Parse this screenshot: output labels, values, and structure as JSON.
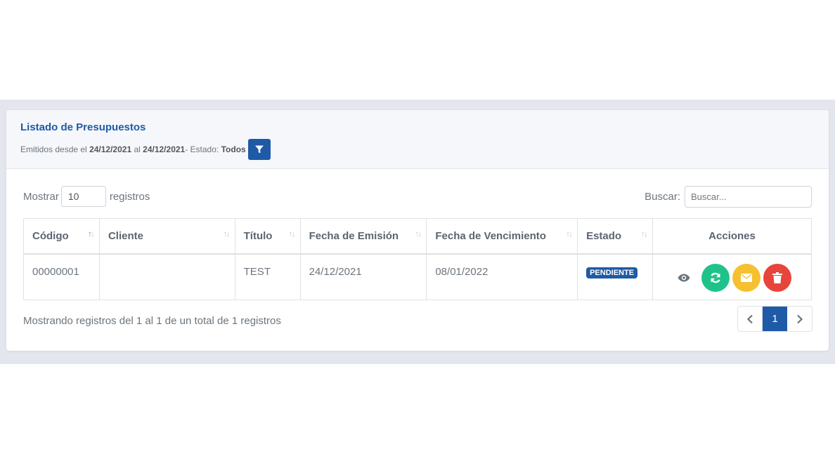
{
  "header": {
    "title": "Listado de Presupuestos",
    "emitidos_label": "Emitidos desde el",
    "date_from": "24/12/2021",
    "al_label": "al",
    "date_to": "24/12/2021",
    "estado_label": "- Estado:",
    "estado_value": "Todos"
  },
  "controls": {
    "show_label": "Mostrar",
    "page_length": "10",
    "records_label": "registros",
    "search_label": "Buscar:",
    "search_placeholder": "Buscar..."
  },
  "table": {
    "columns": [
      "Código",
      "Cliente",
      "Título",
      "Fecha de Emisión",
      "Fecha de Vencimiento",
      "Estado",
      "Acciones"
    ],
    "rows": [
      {
        "codigo": "00000001",
        "cliente": "",
        "titulo": "TEST",
        "fecha_emision": "24/12/2021",
        "fecha_vencimiento": "08/01/2022",
        "estado": "PENDIENTE"
      }
    ]
  },
  "footer": {
    "info": "Mostrando registros del 1 al 1 de un total de 1 registros",
    "current_page": "1"
  },
  "icons": {
    "filter": "filter-icon",
    "view": "eye-icon",
    "convert": "sync-icon",
    "email": "envelope-icon",
    "delete": "trash-icon",
    "prev": "chevron-left-icon",
    "next": "chevron-right-icon"
  },
  "colors": {
    "primary": "#1f5aa6",
    "green": "#1fc38a",
    "yellow": "#f5c130",
    "red": "#e7443b"
  }
}
